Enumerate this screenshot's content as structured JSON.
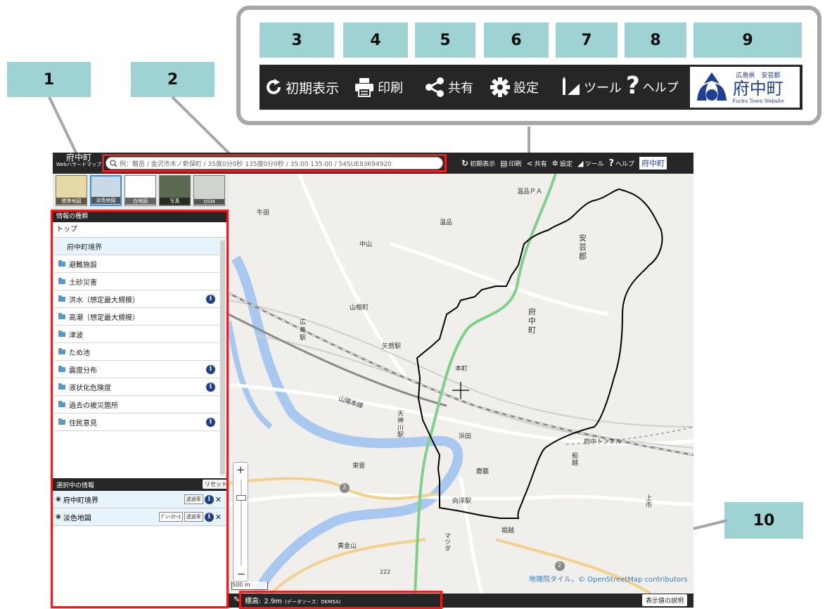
{
  "callouts": {
    "c1": "1",
    "c2": "2",
    "c3": "3",
    "c4": "4",
    "c5": "5",
    "c6": "6",
    "c7": "7",
    "c8": "8",
    "c9": "9",
    "c10": "10"
  },
  "toolbar": {
    "reset": "初期表示",
    "print": "印刷",
    "share": "共有",
    "settings": "設定",
    "tools": "ツール",
    "help": "ヘルプ"
  },
  "logo": {
    "prefecture": "広島県　安芸郡",
    "town": "府中町",
    "website": "Fuchu Town Website"
  },
  "app": {
    "title_line1": "府中町",
    "title_line2": "Webハザードマップ"
  },
  "search": {
    "placeholder": "例：剱岳 / 金沢市木ノ新保町 / 35度0分0秒 135度0分0秒 / 35.00 135.00 / 54SUE83694920"
  },
  "basemaps": [
    "標準地図",
    "淡色地図",
    "白地図",
    "写真",
    "OSM"
  ],
  "sidebar": {
    "header": "情報の種類",
    "top": "トップ",
    "items": [
      {
        "label": "府中町境界",
        "folder": false,
        "info": false
      },
      {
        "label": "避難施設",
        "folder": true,
        "info": false
      },
      {
        "label": "土砂災害",
        "folder": true,
        "info": false
      },
      {
        "label": "洪水（想定最大規模）",
        "folder": true,
        "info": true
      },
      {
        "label": "高潮（想定最大規模）",
        "folder": true,
        "info": false
      },
      {
        "label": "津波",
        "folder": true,
        "info": false
      },
      {
        "label": "ため池",
        "folder": true,
        "info": false
      },
      {
        "label": "震度分布",
        "folder": true,
        "info": true
      },
      {
        "label": "液状化危険度",
        "folder": true,
        "info": true
      },
      {
        "label": "過去の被災箇所",
        "folder": true,
        "info": false
      },
      {
        "label": "住民意見",
        "folder": true,
        "info": true
      }
    ]
  },
  "selected": {
    "header": "選択中の情報",
    "reset": "リセット",
    "rows": [
      {
        "label": "府中町境界",
        "grayscale": "",
        "opacity": "透過率"
      },
      {
        "label": "淡色地図",
        "grayscale": "ｸﾞﾚｰｽｹｰﾙ",
        "opacity": "透過率"
      }
    ]
  },
  "map": {
    "labels": {
      "onsen_pa": "温品ＰＡ",
      "ushita": "牛田",
      "onsen": "温品",
      "nakayama": "中山",
      "aki1": "安",
      "aki2": "芸",
      "aki3": "郡",
      "yamane": "山根町",
      "hiroshima1": "広",
      "hiroshima2": "島",
      "hiroshima3": "駅",
      "yaga": "矢賀駅",
      "fuchu1": "府",
      "fuchu2": "中",
      "fuchu3": "町",
      "honmachi": "本町",
      "sanyo": "山陽本線",
      "tenjin1": "天",
      "tenjin2": "神",
      "tenjin3": "川",
      "tenjin4": "駅",
      "hamada": "浜田",
      "tunnel": "府中トンネル",
      "funakoshi1": "船",
      "funakoshi2": "越",
      "higashi": "東雲",
      "kagami": "鹿籠",
      "mukainada": "向洋駅",
      "kogane": "黄金山",
      "horikoshi": "堀越",
      "mazda": "マツダ",
      "kami1": "上",
      "kami2": "市",
      "elev222": "222",
      "route2": "2"
    },
    "scale": "500 m",
    "attribution": "地理院タイル，© OpenStreetMap contributors"
  },
  "status": {
    "elevation_label": "標高:",
    "elevation_value": "2.9m",
    "source": "(データソース：DEM5A)",
    "explain_button": "表示値の説明"
  },
  "mini_toolbar": {
    "reset": "初期表示",
    "print": "印刷",
    "share": "共有",
    "settings": "設定",
    "tools": "ツール",
    "help": "ヘルプ",
    "logo": "府中町"
  },
  "colors": {
    "callout": "#9fd3d3",
    "highlight": "#ee1c1c",
    "toolbar": "#262626",
    "info": "#1e3f8a",
    "river": "#a9c8ef",
    "rail_green": "#7fd089",
    "boundary": "#000000"
  }
}
